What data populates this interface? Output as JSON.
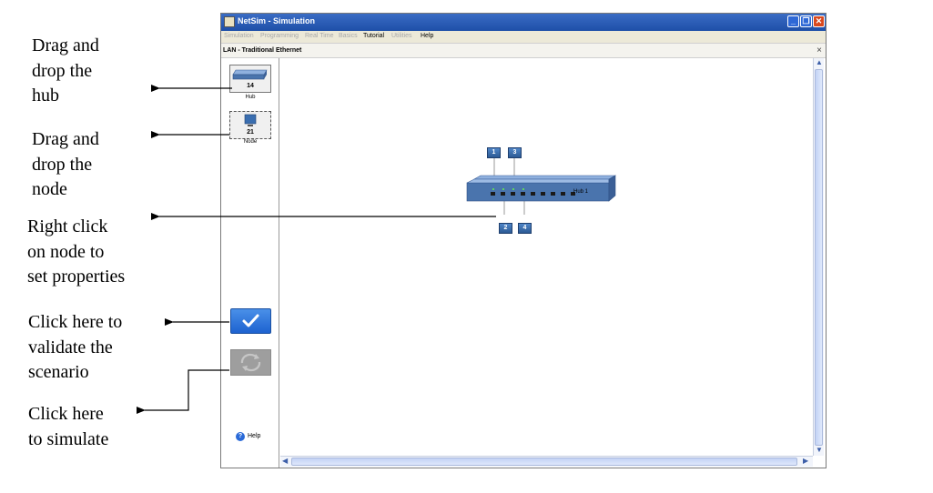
{
  "annotations": {
    "hub": "Drag and\ndrop the\nhub",
    "node": "Drag and\ndrop the\nnode",
    "properties": "Right click\non node to\nset properties",
    "validate": "Click here to\nvalidate the\nscenario",
    "simulate": "Click here\nto simulate"
  },
  "window": {
    "title": "NetSim - Simulation",
    "controls": {
      "minimize": "_",
      "restore": "❐",
      "close": "✕"
    }
  },
  "menu": [
    {
      "label": "Simulation",
      "enabled": false
    },
    {
      "label": "Programming",
      "enabled": false
    },
    {
      "label": "Real Time",
      "enabled": false
    },
    {
      "label": "Basics",
      "enabled": false
    },
    {
      "label": "Tutorial",
      "enabled": true
    },
    {
      "label": "Utilities",
      "enabled": false
    },
    {
      "label": "Help",
      "enabled": true
    }
  ],
  "tab": {
    "title": "LAN - Traditional Ethernet",
    "close": "×"
  },
  "palette": {
    "hub": {
      "count": "14",
      "label": "Hub"
    },
    "node": {
      "count": "21",
      "label": "Node"
    },
    "help_label": "Help",
    "help_icon": "?"
  },
  "canvas": {
    "hub_label": "Hub 1",
    "nodes": {
      "n1": "1",
      "n2": "2",
      "n3": "3",
      "n4": "4"
    }
  },
  "icons": [
    "netsim-app-icon",
    "hub-icon",
    "node-icon",
    "validate-check-icon",
    "simulate-icon",
    "help-icon",
    "close-icon"
  ],
  "colors": {
    "titlebar": "#1e4fa8",
    "validate_button": "#1d62d0",
    "node_blue": "#3a6eb0",
    "hub_blue": "#4a74ad"
  }
}
